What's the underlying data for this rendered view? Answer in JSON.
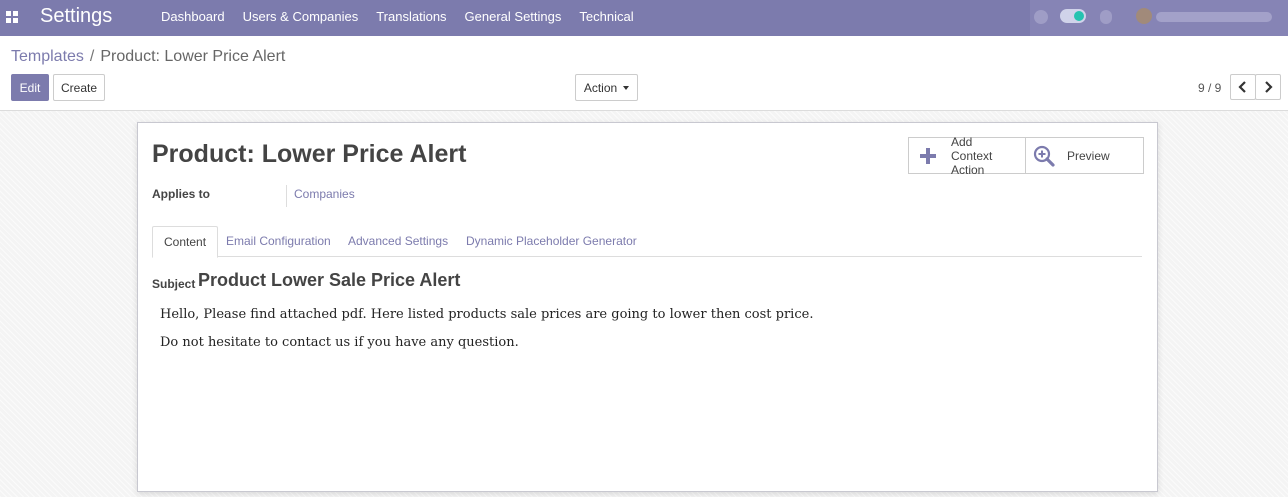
{
  "navbar": {
    "app_title": "Settings",
    "menu": [
      "Dashboard",
      "Users & Companies",
      "Translations",
      "General Settings",
      "Technical"
    ],
    "apps_icon": "grid-icon",
    "accent_color": "#7c7bad"
  },
  "breadcrumb": {
    "parent": "Templates",
    "separator": "/",
    "current": "Product: Lower Price Alert"
  },
  "toolbar": {
    "edit_label": "Edit",
    "create_label": "Create",
    "action_label": "Action"
  },
  "pager": {
    "value": "9 / 9",
    "prev_icon": "chevron-left-icon",
    "next_icon": "chevron-right-icon"
  },
  "record": {
    "title": "Product: Lower Price Alert",
    "applies_to_label": "Applies to",
    "applies_to_value": "Companies"
  },
  "smart_buttons": {
    "add_line1": "Add",
    "add_line2": "Context Action",
    "add_icon": "plus-icon",
    "preview_label": "Preview",
    "preview_icon": "zoom-in-icon"
  },
  "tabs": [
    "Content",
    "Email Configuration",
    "Advanced Settings",
    "Dynamic Placeholder Generator"
  ],
  "content": {
    "subject_label": "Subject",
    "subject_value": "Product Lower Sale Price Alert",
    "body_line1": "Hello, Please find attached pdf. Here listed products sale prices are going to lower then cost price.",
    "body_line2": "Do not hesitate to contact us if you have any question."
  }
}
